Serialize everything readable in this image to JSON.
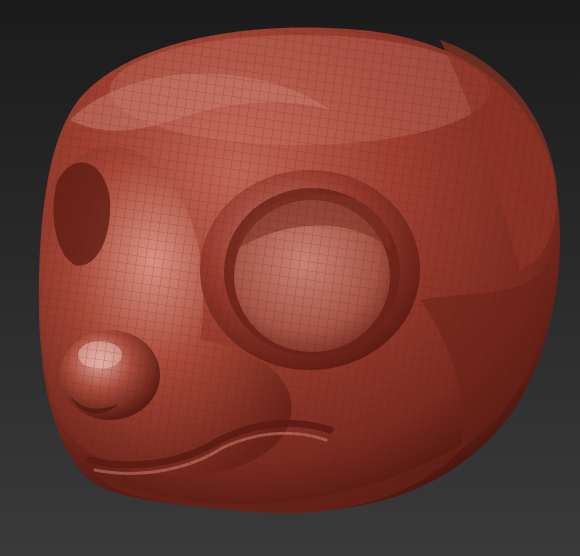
{
  "viewport": {
    "background_top": "#1b1b1b",
    "background_bottom": "#3a3a3a"
  },
  "model": {
    "subject": "sculpted-head-mesh",
    "material_color": "#9a3a2c",
    "highlight_color": "#d9a59a",
    "shadow_color": "#4a150f",
    "wireframe_color": "#5a1d15"
  }
}
